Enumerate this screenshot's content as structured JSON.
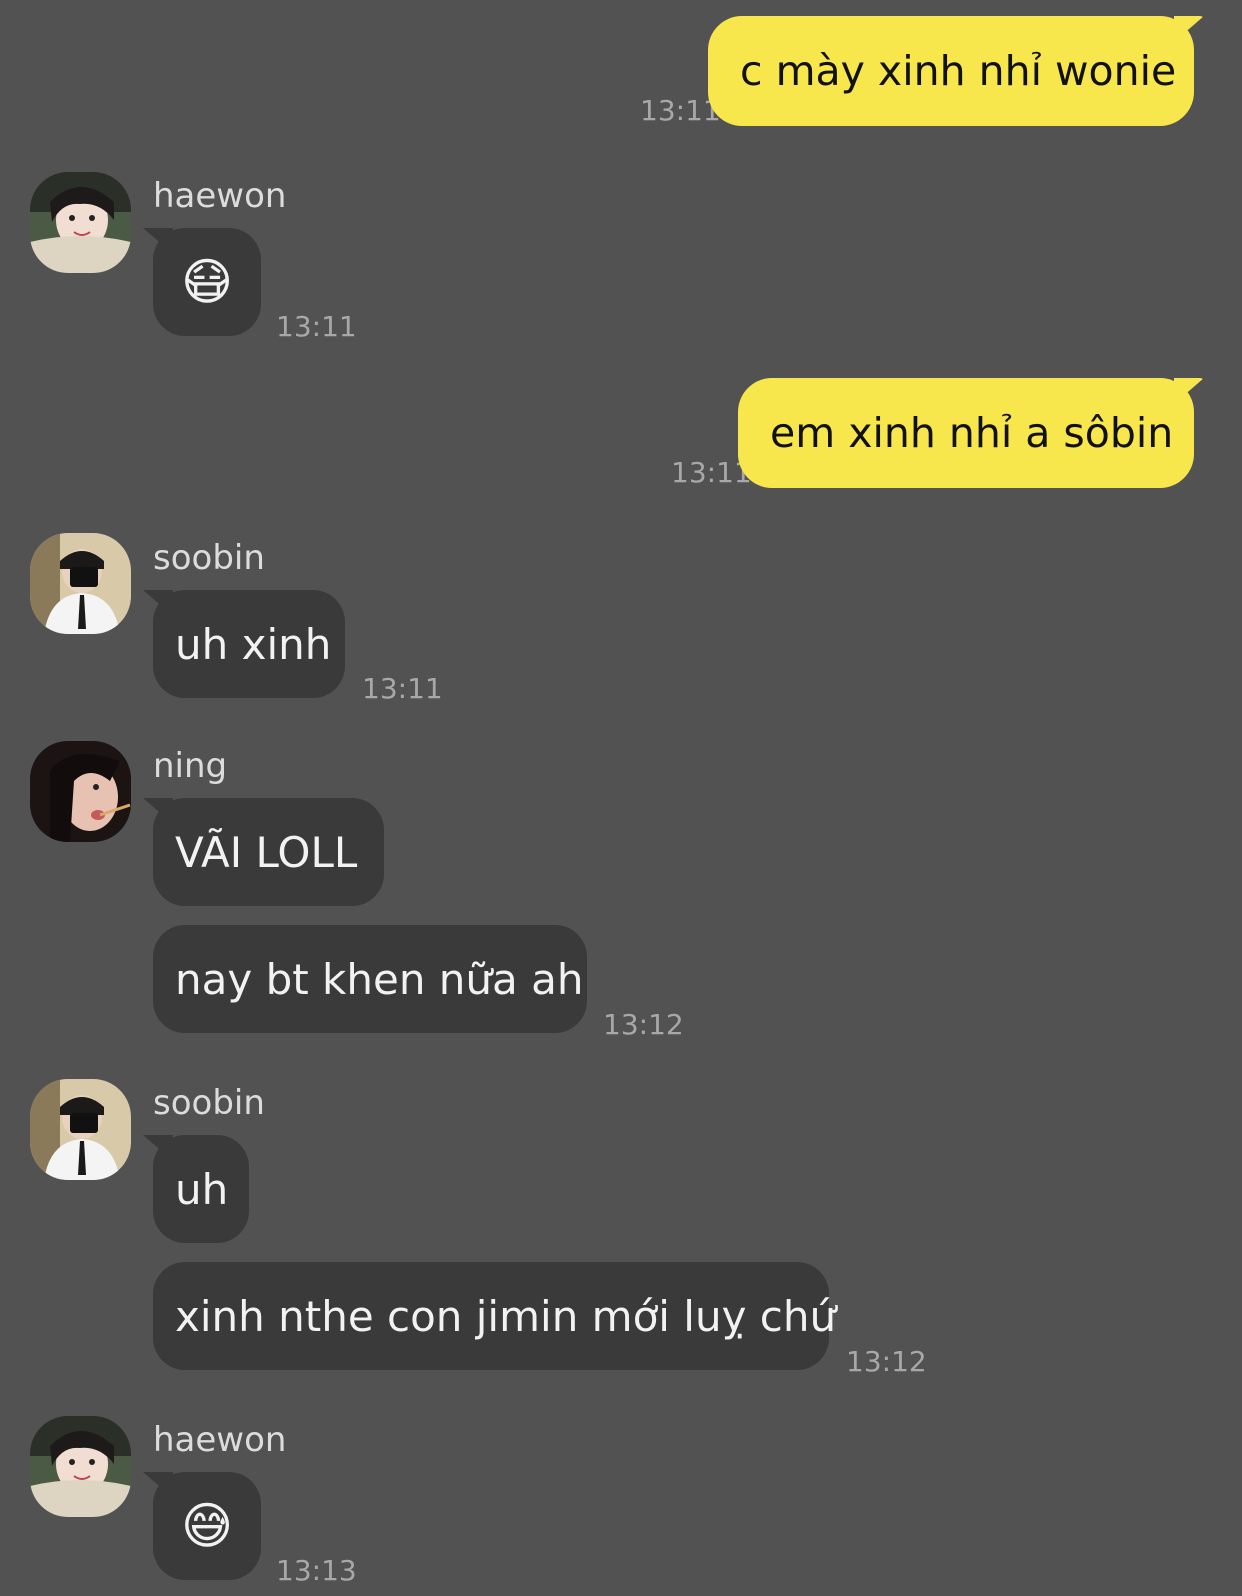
{
  "colors": {
    "background": "#535253",
    "outgoing_bubble": "#f8e64d",
    "incoming_bubble": "#3b3a3b",
    "timestamp": "#a9a8a9"
  },
  "messages": [
    {
      "direction": "out",
      "text": "c mày xinh nhỉ wonie",
      "time": "13:11"
    },
    {
      "direction": "in",
      "sender": "haewon",
      "avatar": "haewon-avatar",
      "bubbles": [
        "😷"
      ],
      "time": "13:11"
    },
    {
      "direction": "out",
      "text": "em xinh nhỉ a sôbin",
      "time": "13:11"
    },
    {
      "direction": "in",
      "sender": "soobin",
      "avatar": "soobin-avatar",
      "bubbles": [
        "uh xinh"
      ],
      "time": "13:11"
    },
    {
      "direction": "in",
      "sender": "ning",
      "avatar": "ning-avatar",
      "bubbles": [
        "VÃI LOLL",
        "nay bt khen nữa ah"
      ],
      "time": "13:12"
    },
    {
      "direction": "in",
      "sender": "soobin",
      "avatar": "soobin-avatar",
      "bubbles": [
        "uh",
        "xinh nthe con jimin mới luỵ chứ"
      ],
      "time": "13:12"
    },
    {
      "direction": "in",
      "sender": "haewon",
      "avatar": "haewon-avatar",
      "bubbles": [
        "😅"
      ],
      "time": "13:13"
    }
  ]
}
